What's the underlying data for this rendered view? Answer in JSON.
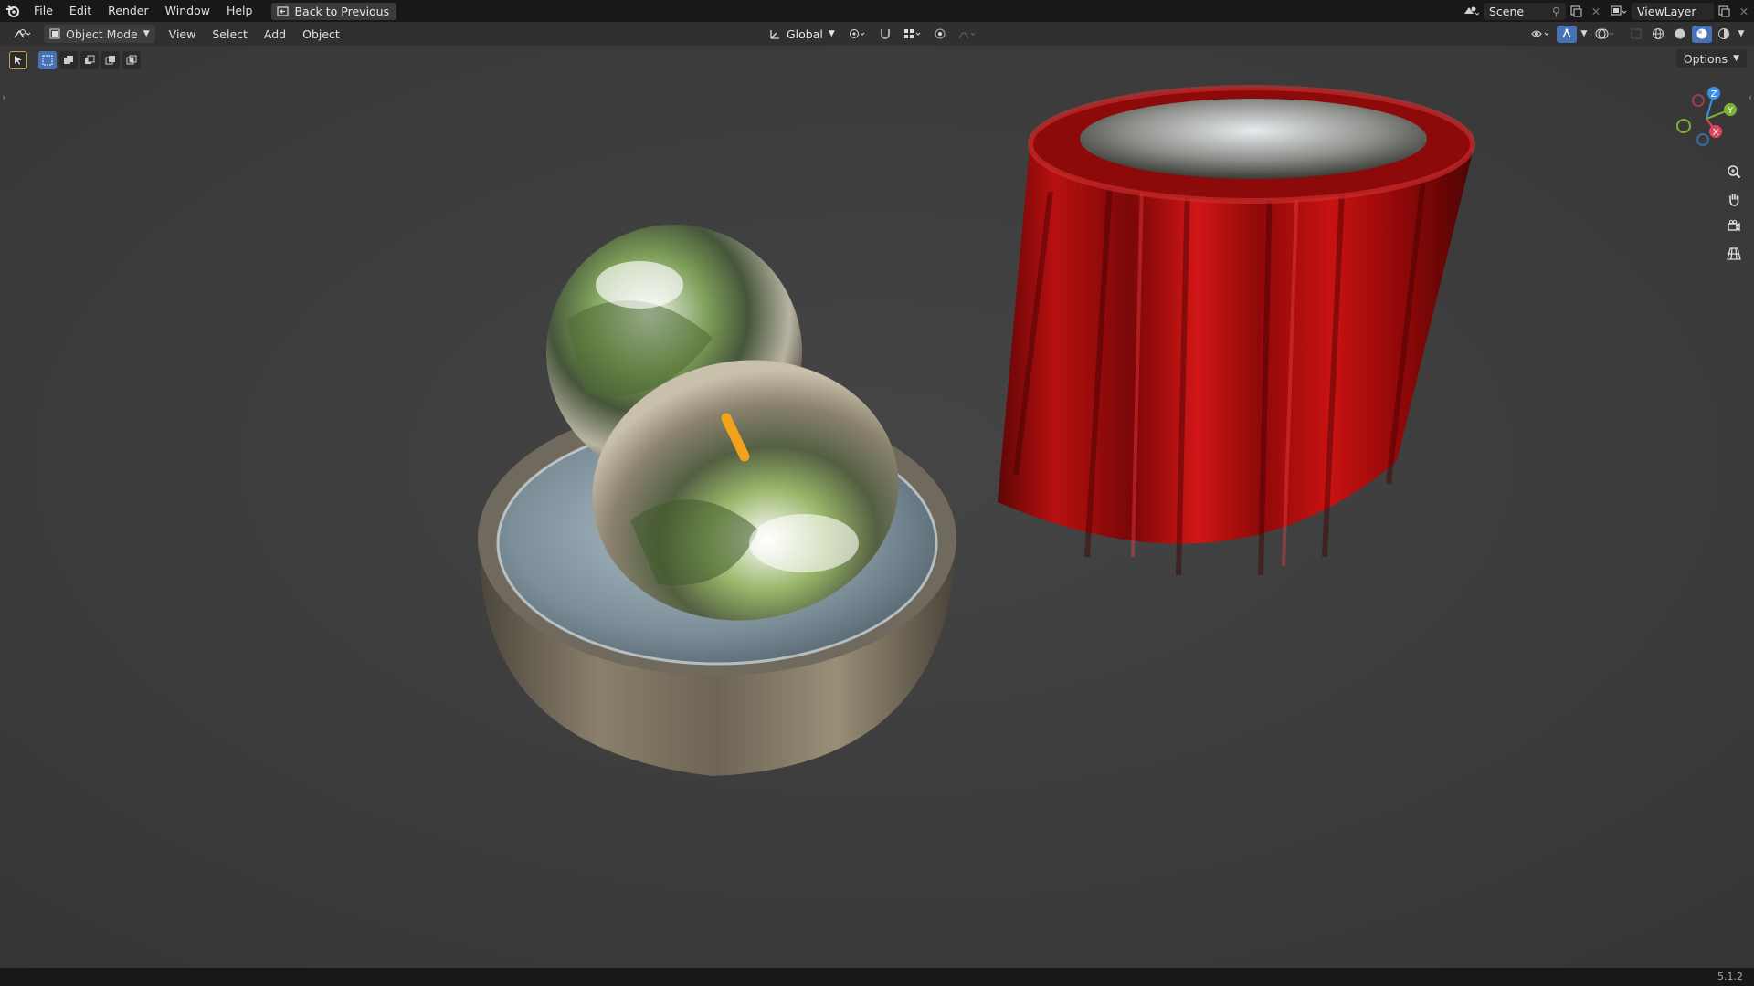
{
  "menubar": {
    "items": [
      "File",
      "Edit",
      "Render",
      "Window",
      "Help"
    ],
    "back_button": "Back to Previous",
    "scene_name": "Scene",
    "view_layer_name": "ViewLayer"
  },
  "header": {
    "mode": "Object Mode",
    "menus": [
      "View",
      "Select",
      "Add",
      "Object"
    ],
    "transform_orientation": "Global"
  },
  "viewport": {
    "options_label": "Options",
    "gizmo_axes": [
      "Z",
      "Y",
      "X"
    ],
    "nav_icons": [
      "zoom-icon",
      "pan-hand-icon",
      "camera-view-icon",
      "perspective-grid-icon"
    ]
  },
  "statusbar": {
    "version": "5.1.2"
  },
  "colors": {
    "accent": "#4772b3",
    "axis_x": "#e04660",
    "axis_y": "#7fb135",
    "axis_z": "#3d8ee8",
    "viewport_bg": "#3c3c3c"
  }
}
